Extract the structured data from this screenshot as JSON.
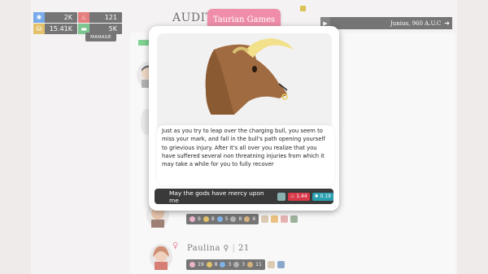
{
  "resources": [
    {
      "icon": "snowflake-icon",
      "value": "2K",
      "color": "#2f7de1"
    },
    {
      "icon": "fire-icon",
      "value": "121",
      "color": "#d83a3a"
    },
    {
      "icon": "coins-icon",
      "value": "15.41K",
      "color": "#d4a21c"
    },
    {
      "icon": "money-icon",
      "value": "5K",
      "color": "#3aa856"
    }
  ],
  "manage_label": "MANAGE",
  "header": {
    "title": "AUDIT",
    "brand": "Taurian Games",
    "date": "Junius, 960 A.U.C"
  },
  "background": {
    "row1": {
      "s1": "9",
      "s2": "8",
      "s3": "5",
      "s4": "8",
      "s5": "6"
    },
    "character": {
      "name": "Paulina",
      "age": "21"
    },
    "row2": {
      "s1": "19",
      "s2": "8",
      "s3": "3",
      "s4": "3",
      "s5": "11"
    }
  },
  "event": {
    "text": "Just as you try to leap over the charging bull, you seem to miss your mark, and fall in the bull's path opening yourself to grievious injury. After it's all over you realize that you have suffered several non threatning injuries from which it may take a while for you to fully recover",
    "action": "May the gods have mercy upon me",
    "cost1": "1.44",
    "cost2": "0.19"
  },
  "colors": {
    "brand": "#e8527c",
    "dark": "#2b2b2b",
    "cost_red": "#d83a4a",
    "cost_teal": "#2a9fb0"
  }
}
